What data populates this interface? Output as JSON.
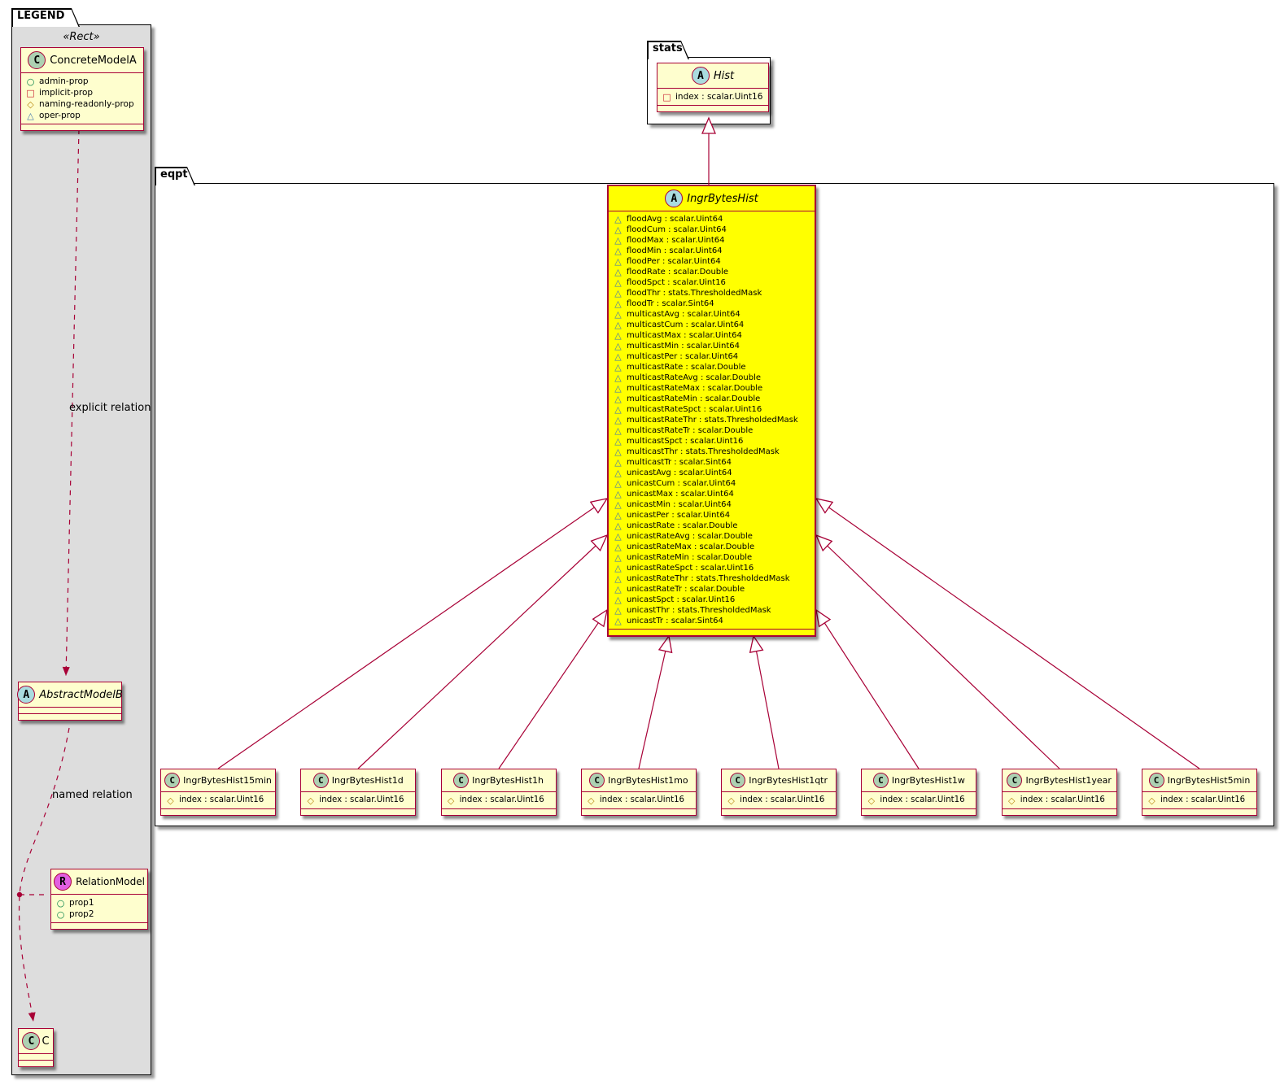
{
  "diagram": {
    "legend": {
      "tab": "LEGEND",
      "stereotype": "«Rect»",
      "explicit_relation_label": "explicit relation",
      "named_relation_label": "named relation",
      "concrete_model": {
        "letter": "C",
        "name": "ConcreteModelA",
        "attributes": [
          {
            "icon": "admin",
            "label": "admin-prop"
          },
          {
            "icon": "implicit",
            "label": "implicit-prop"
          },
          {
            "icon": "naming",
            "label": "naming-readonly-prop"
          },
          {
            "icon": "oper",
            "label": "oper-prop"
          }
        ]
      },
      "abstract_model": {
        "letter": "A",
        "name": "AbstractModelB"
      },
      "relation_model": {
        "letter": "R",
        "name": "RelationModel",
        "attributes": [
          {
            "icon": "admin",
            "label": "prop1"
          },
          {
            "icon": "admin",
            "label": "prop2"
          }
        ]
      },
      "c_model": {
        "letter": "C",
        "name": "C"
      }
    },
    "stats_package": {
      "tab": "stats",
      "hist": {
        "letter": "A",
        "name": "Hist",
        "attributes": [
          {
            "icon": "implicit",
            "label": "index : scalar.Uint16"
          }
        ]
      }
    },
    "eqpt_package": {
      "tab": "eqpt",
      "ingr_bytes_hist": {
        "letter": "A",
        "name": "IngrBytesHist",
        "attributes": [
          {
            "icon": "oper",
            "label": "floodAvg : scalar.Uint64"
          },
          {
            "icon": "oper",
            "label": "floodCum : scalar.Uint64"
          },
          {
            "icon": "oper",
            "label": "floodMax : scalar.Uint64"
          },
          {
            "icon": "oper",
            "label": "floodMin : scalar.Uint64"
          },
          {
            "icon": "oper",
            "label": "floodPer : scalar.Uint64"
          },
          {
            "icon": "oper",
            "label": "floodRate : scalar.Double"
          },
          {
            "icon": "oper",
            "label": "floodSpct : scalar.Uint16"
          },
          {
            "icon": "oper",
            "label": "floodThr : stats.ThresholdedMask"
          },
          {
            "icon": "oper",
            "label": "floodTr : scalar.Sint64"
          },
          {
            "icon": "oper",
            "label": "multicastAvg : scalar.Uint64"
          },
          {
            "icon": "oper",
            "label": "multicastCum : scalar.Uint64"
          },
          {
            "icon": "oper",
            "label": "multicastMax : scalar.Uint64"
          },
          {
            "icon": "oper",
            "label": "multicastMin : scalar.Uint64"
          },
          {
            "icon": "oper",
            "label": "multicastPer : scalar.Uint64"
          },
          {
            "icon": "oper",
            "label": "multicastRate : scalar.Double"
          },
          {
            "icon": "oper",
            "label": "multicastRateAvg : scalar.Double"
          },
          {
            "icon": "oper",
            "label": "multicastRateMax : scalar.Double"
          },
          {
            "icon": "oper",
            "label": "multicastRateMin : scalar.Double"
          },
          {
            "icon": "oper",
            "label": "multicastRateSpct : scalar.Uint16"
          },
          {
            "icon": "oper",
            "label": "multicastRateThr : stats.ThresholdedMask"
          },
          {
            "icon": "oper",
            "label": "multicastRateTr : scalar.Double"
          },
          {
            "icon": "oper",
            "label": "multicastSpct : scalar.Uint16"
          },
          {
            "icon": "oper",
            "label": "multicastThr : stats.ThresholdedMask"
          },
          {
            "icon": "oper",
            "label": "multicastTr : scalar.Sint64"
          },
          {
            "icon": "oper",
            "label": "unicastAvg : scalar.Uint64"
          },
          {
            "icon": "oper",
            "label": "unicastCum : scalar.Uint64"
          },
          {
            "icon": "oper",
            "label": "unicastMax : scalar.Uint64"
          },
          {
            "icon": "oper",
            "label": "unicastMin : scalar.Uint64"
          },
          {
            "icon": "oper",
            "label": "unicastPer : scalar.Uint64"
          },
          {
            "icon": "oper",
            "label": "unicastRate : scalar.Double"
          },
          {
            "icon": "oper",
            "label": "unicastRateAvg : scalar.Double"
          },
          {
            "icon": "oper",
            "label": "unicastRateMax : scalar.Double"
          },
          {
            "icon": "oper",
            "label": "unicastRateMin : scalar.Double"
          },
          {
            "icon": "oper",
            "label": "unicastRateSpct : scalar.Uint16"
          },
          {
            "icon": "oper",
            "label": "unicastRateThr : stats.ThresholdedMask"
          },
          {
            "icon": "oper",
            "label": "unicastRateTr : scalar.Double"
          },
          {
            "icon": "oper",
            "label": "unicastSpct : scalar.Uint16"
          },
          {
            "icon": "oper",
            "label": "unicastThr : stats.ThresholdedMask"
          },
          {
            "icon": "oper",
            "label": "unicastTr : scalar.Sint64"
          }
        ]
      },
      "subclasses": [
        {
          "letter": "C",
          "name": "IngrBytesHist15min",
          "attribute": {
            "icon": "naming",
            "label": "index : scalar.Uint16"
          }
        },
        {
          "letter": "C",
          "name": "IngrBytesHist1d",
          "attribute": {
            "icon": "naming",
            "label": "index : scalar.Uint16"
          }
        },
        {
          "letter": "C",
          "name": "IngrBytesHist1h",
          "attribute": {
            "icon": "naming",
            "label": "index : scalar.Uint16"
          }
        },
        {
          "letter": "C",
          "name": "IngrBytesHist1mo",
          "attribute": {
            "icon": "naming",
            "label": "index : scalar.Uint16"
          }
        },
        {
          "letter": "C",
          "name": "IngrBytesHist1qtr",
          "attribute": {
            "icon": "naming",
            "label": "index : scalar.Uint16"
          }
        },
        {
          "letter": "C",
          "name": "IngrBytesHist1w",
          "attribute": {
            "icon": "naming",
            "label": "index : scalar.Uint16"
          }
        },
        {
          "letter": "C",
          "name": "IngrBytesHist1year",
          "attribute": {
            "icon": "naming",
            "label": "index : scalar.Uint16"
          }
        },
        {
          "letter": "C",
          "name": "IngrBytesHist5min",
          "attribute": {
            "icon": "naming",
            "label": "index : scalar.Uint16"
          }
        }
      ]
    },
    "colors": {
      "line_accent": "#A80036",
      "class_fill": "#FEFECE",
      "highlight_fill": "#FFFF00",
      "legend_fill": "#DDDDDD",
      "spot_class": "#ADD1B2",
      "spot_abstract": "#A9DCDF",
      "spot_relation": "#E15FE1",
      "icon_admin": "#038048",
      "icon_implicit": "#C82130",
      "icon_naming": "#B8860B",
      "icon_oper": "#4177AF"
    }
  }
}
